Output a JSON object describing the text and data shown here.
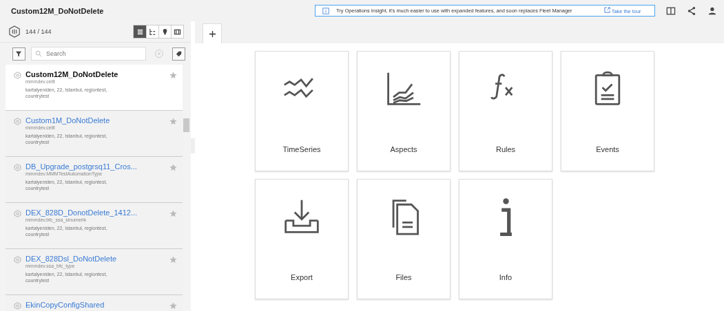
{
  "header": {
    "title": "Custom12M_DoNotDelete",
    "banner": {
      "message": "Try Operations Insight, it's much easier to use with expanded features, and soon replaces Fleet Manager",
      "link": "Take the tour"
    }
  },
  "sidebar": {
    "count": "144 / 144",
    "views": [
      {
        "kind": "list",
        "selected": true
      },
      {
        "kind": "tree",
        "selected": false
      },
      {
        "kind": "map",
        "selected": false
      },
      {
        "kind": "panel",
        "selected": false
      }
    ],
    "search": {
      "placeholder": "Search"
    },
    "assets": [
      {
        "name": "Custom12M_DoNotDelete",
        "type": "mmmdev.cellt",
        "address": "kartalyeniden, 22, Istanbul, regiontest, countrytest",
        "selected": true
      },
      {
        "name": "Custom1M_DoNotDelete",
        "type": "mmmdev.cellt",
        "address": "kartalyeniden, 22, Istanbul, regiontest, countrytest",
        "selected": false
      },
      {
        "name": "DB_Upgrade_postgrsq11_Cros...",
        "type": "mmmdev.MMMTestAutomationType",
        "address": "kartalyeniden, 22, Istanbul, regiontest, countrytest",
        "selected": false
      },
      {
        "name": "DEX_828D_DonotDelete_1412...",
        "type": "mmmdev.bfc_ssa_sinumerik",
        "address": "kartalyeniden, 22, Istanbul, regiontest, countrytest",
        "selected": false
      },
      {
        "name": "DEX_828Dsl_DoNotDelete",
        "type": "mmmdev.ssa_bfc_type",
        "address": "kartalyeniden, 22, Istanbul, regiontest, countrytest",
        "selected": false
      },
      {
        "name": "EkinCopyConfigShared",
        "selected": false
      }
    ]
  },
  "tiles": [
    {
      "kind": "timeseries",
      "label": "TimeSeries"
    },
    {
      "kind": "aspects",
      "label": "Aspects"
    },
    {
      "kind": "rules",
      "label": "Rules"
    },
    {
      "kind": "events",
      "label": "Events"
    },
    {
      "kind": "export",
      "label": "Export"
    },
    {
      "kind": "files",
      "label": "Files"
    },
    {
      "kind": "info",
      "label": "Info"
    }
  ]
}
